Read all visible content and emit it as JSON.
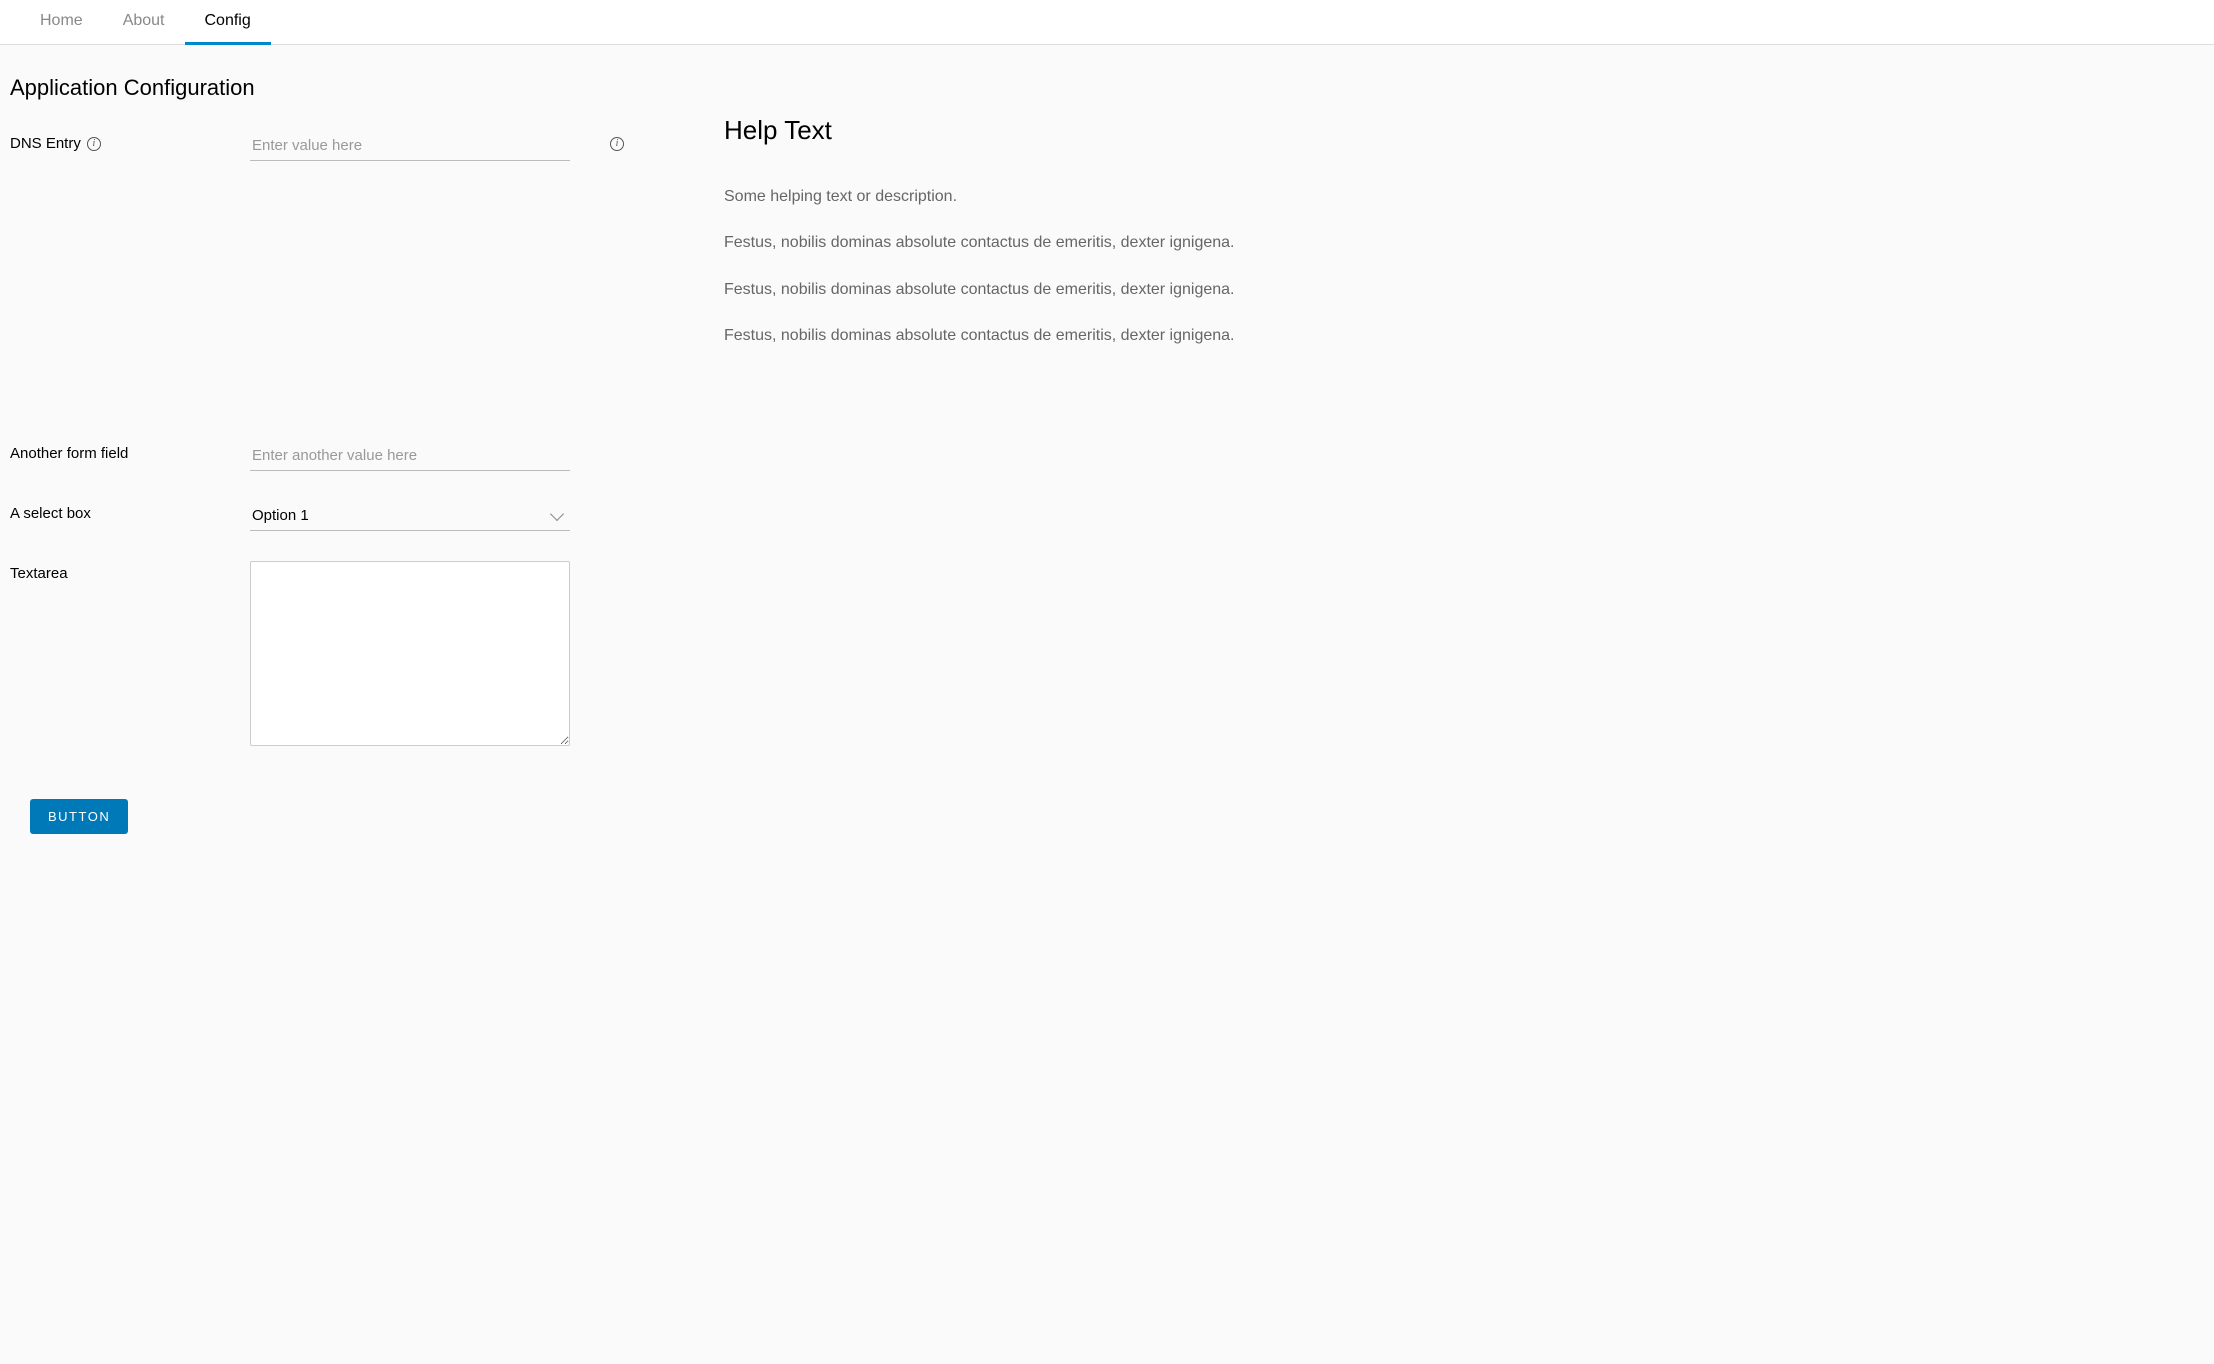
{
  "tabs": {
    "home": "Home",
    "about": "About",
    "config": "Config"
  },
  "page_title": "Application Configuration",
  "form": {
    "dns_entry": {
      "label": "DNS Entry",
      "placeholder": "Enter value here"
    },
    "another_field": {
      "label": "Another form field",
      "placeholder": "Enter another value here"
    },
    "select_box": {
      "label": "A select box",
      "selected": "Option 1"
    },
    "textarea": {
      "label": "Textarea"
    },
    "submit_button": "BUTTON"
  },
  "help": {
    "title": "Help Text",
    "paragraphs": [
      "Some helping text or description.",
      "Festus, nobilis dominas absolute contactus de emeritis, dexter ignigena.",
      "Festus, nobilis dominas absolute contactus de emeritis, dexter ignigena.",
      "Festus, nobilis dominas absolute contactus de emeritis, dexter ignigena."
    ]
  }
}
